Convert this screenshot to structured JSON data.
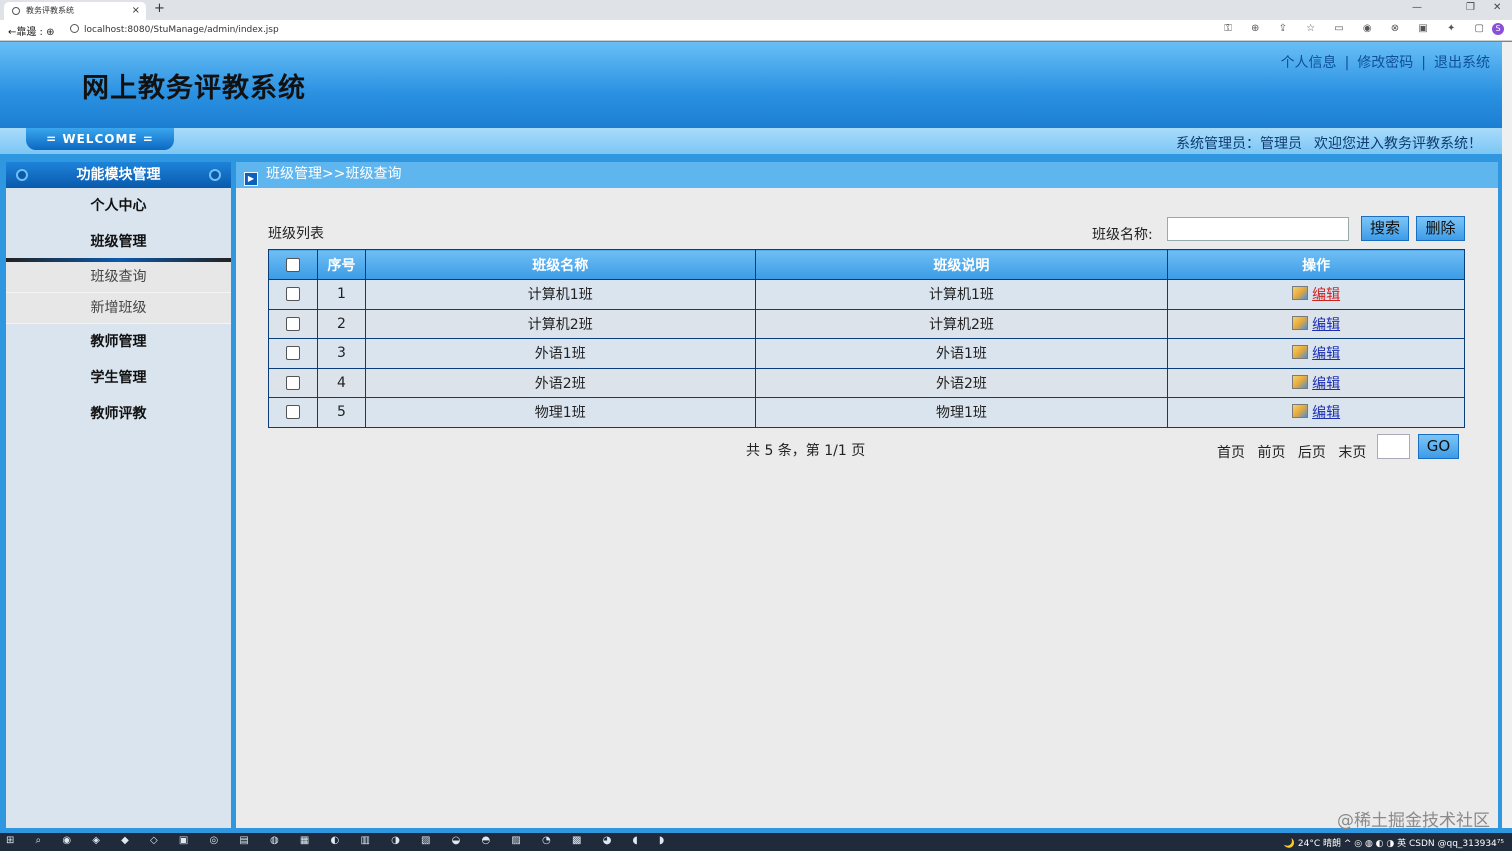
{
  "browser": {
    "tab_title": "教务评教系统",
    "tab_close": "×",
    "new_tab": "+",
    "url": "localhost:8080/StuManage/admin/index.jsp",
    "nav": "←靠邊 : ⊕",
    "win_min": "—",
    "win_max": "❐",
    "win_close": "✕",
    "toolbar_icons": "⚿ ⊕ ⇪ ☆ ▭ ◉ ⊗ ▣ ✦ ▢",
    "profile_letter": "S"
  },
  "header": {
    "title": "网上教务评教系统",
    "links": [
      "个人信息",
      "修改密码",
      "退出系统"
    ],
    "separator": "|",
    "welcome": "= WELCOME =",
    "role_label": "系统管理员：",
    "user_name": "管理员",
    "greeting": "欢迎您进入教务评教系统！"
  },
  "sidebar": {
    "title": "功能模块管理",
    "items": [
      {
        "label": "个人中心"
      },
      {
        "label": "班级管理",
        "children": [
          "班级查询",
          "新增班级"
        ]
      },
      {
        "label": "教师管理"
      },
      {
        "label": "学生管理"
      },
      {
        "label": "教师评教"
      }
    ]
  },
  "content": {
    "breadcrumb": "班级管理>>班级查询",
    "list_title": "班级列表",
    "search_label": "班级名称:",
    "search_value": "",
    "search_button": "搜索",
    "delete_button": "删除",
    "columns": [
      "序号",
      "班级名称",
      "班级说明",
      "操作"
    ],
    "rows": [
      {
        "no": "1",
        "name": "计算机1班",
        "desc": "计算机1班",
        "action": "编辑"
      },
      {
        "no": "2",
        "name": "计算机2班",
        "desc": "计算机2班",
        "action": "编辑"
      },
      {
        "no": "3",
        "name": "外语1班",
        "desc": "外语1班",
        "action": "编辑"
      },
      {
        "no": "4",
        "name": "外语2班",
        "desc": "外语2班",
        "action": "编辑"
      },
      {
        "no": "5",
        "name": "物理1班",
        "desc": "物理1班",
        "action": "编辑"
      }
    ],
    "pager_total": "共 5 条，第 1/1 页",
    "pager_links": [
      "首页",
      "前页",
      "后页",
      "末页"
    ],
    "go_button": "GO"
  },
  "watermark": "@稀土掘金技术社区",
  "taskbar": {
    "icons": "⊞ ⌕ ◉ ◈ ◆ ◇ ▣ ◎ ▤ ◍ ▦ ◐ ▥ ◑ ▧ ◒ ◓ ▨ ◔ ▩ ◕ ◖ ◗",
    "tray": "🌙 24°C 晴朗 ^ ◎ ◍ ◐ ◑ 英 CSDN @qq_313934⁷⁵"
  },
  "colors": {
    "header_blue": "#2a91e2",
    "link_blue": "#0e4f9c",
    "table_border": "#0b3d7a",
    "edit_active": "#d32222"
  }
}
